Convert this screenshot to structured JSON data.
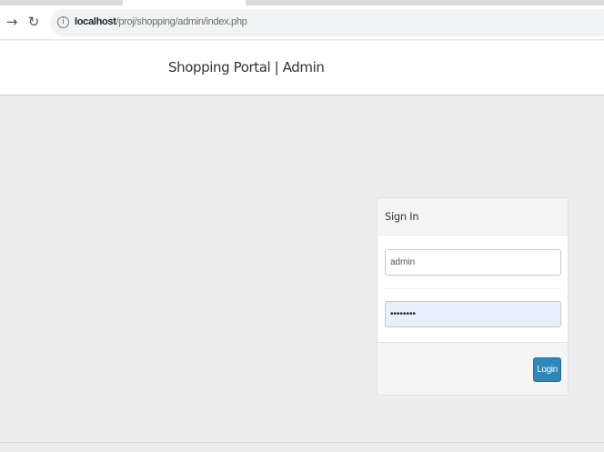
{
  "browser": {
    "nav_forward_glyph": "→",
    "nav_reload_glyph": "↻",
    "info_glyph": "i",
    "url_host": "localhost",
    "url_path": "/proj/shopping/admin/index.php"
  },
  "header": {
    "brand": "Shopping Portal | Admin"
  },
  "login": {
    "title": "Sign In",
    "username_value": "admin",
    "password_value": "••••••••",
    "login_label": "Login"
  },
  "colors": {
    "primary_button": "#2f86b9",
    "autofill_bg": "#e8f0fe",
    "page_bg": "#ededed"
  },
  "icons": {
    "forward": "arrow-forward-icon",
    "reload": "reload-icon",
    "info": "site-info-icon"
  }
}
